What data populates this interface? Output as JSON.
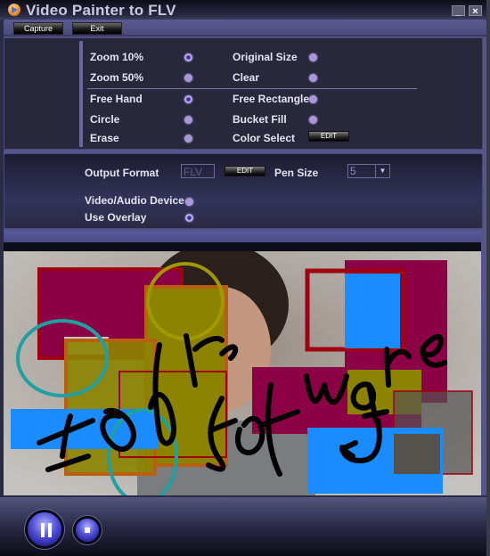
{
  "window": {
    "title": "Video Painter to FLV",
    "minimize_label": "_",
    "close_label": "×"
  },
  "toolbar": {
    "capture_label": "Capture",
    "exit_label": "Exit"
  },
  "options": {
    "zoom10": {
      "label": "Zoom 10%",
      "selected": true
    },
    "original_size": {
      "label": "Original Size",
      "selected": false
    },
    "zoom50": {
      "label": "Zoom 50%",
      "selected": false
    },
    "clear": {
      "label": "Clear",
      "selected": false
    },
    "free_hand": {
      "label": "Free Hand",
      "selected": true
    },
    "free_rectangle": {
      "label": "Free Rectangle",
      "selected": false
    },
    "circle": {
      "label": "Circle",
      "selected": false
    },
    "bucket_fill": {
      "label": "Bucket Fill",
      "selected": false
    },
    "erase": {
      "label": "Erase",
      "selected": false
    },
    "color_select": {
      "label": "Color Select",
      "edit_label": "EDIT"
    }
  },
  "output": {
    "format_label": "Output Format",
    "format_value": "FLV",
    "edit_label": "EDIT",
    "pen_size_label": "Pen Size",
    "pen_size_value": "5",
    "device_label": "Video/Audio Device",
    "device_selected": false,
    "overlay_label": "Use Overlay",
    "overlay_selected": true
  },
  "video": {
    "overlay_text": [
      "I",
      "free",
      "Software"
    ],
    "colors": {
      "magenta": "#8c0046",
      "red": "#a00010",
      "olive": "#8c8400",
      "orange": "#b86010",
      "teal": "#20a0a0",
      "blue": "#1a8cff",
      "yellow_ring": "#a09a00"
    }
  },
  "playback": {
    "pause_icon": "pause-icon",
    "stop_icon": "stop-icon"
  }
}
